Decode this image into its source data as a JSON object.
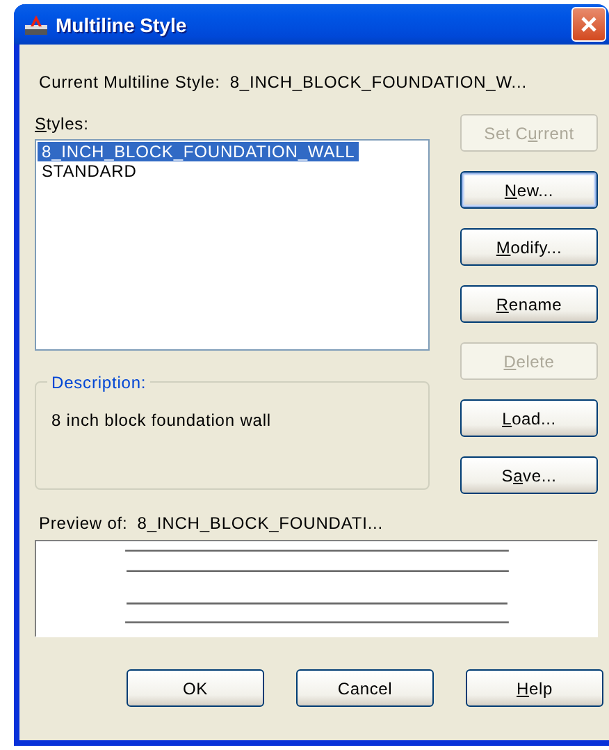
{
  "window": {
    "title": "Multiline Style"
  },
  "current_style": {
    "label": "Current Multiline Style:",
    "value": "8_INCH_BLOCK_FOUNDATION_W..."
  },
  "styles": {
    "label": {
      "key": "S",
      "after": "tyles:"
    },
    "items": [
      {
        "name": "8_INCH_BLOCK_FOUNDATION_WALL",
        "selected": true
      },
      {
        "name": "STANDARD",
        "selected": false
      }
    ]
  },
  "side_buttons": [
    {
      "label": {
        "before": "Set C",
        "key": "u",
        "after": "rrent"
      },
      "disabled": true,
      "default": false
    },
    {
      "label": {
        "key": "N",
        "after": "ew..."
      },
      "disabled": false,
      "default": true
    },
    {
      "label": {
        "key": "M",
        "after": "odify..."
      },
      "disabled": false,
      "default": false
    },
    {
      "label": {
        "key": "R",
        "after": "ename"
      },
      "disabled": false,
      "default": false
    },
    {
      "label": {
        "key": "D",
        "after": "elete"
      },
      "disabled": true,
      "default": false
    },
    {
      "label": {
        "key": "L",
        "after": "oad..."
      },
      "disabled": false,
      "default": false
    },
    {
      "label": {
        "before": "S",
        "key": "a",
        "after": "ve..."
      },
      "disabled": false,
      "default": false
    }
  ],
  "description": {
    "label": "Description:",
    "text": "8 inch block foundation wall"
  },
  "preview": {
    "label": "Preview of:",
    "value": "8_INCH_BLOCK_FOUNDATI..."
  },
  "bottom_buttons": [
    {
      "label": {
        "after": "OK"
      },
      "disabled": false,
      "default": false
    },
    {
      "label": {
        "after": "Cancel"
      },
      "disabled": false,
      "default": false
    },
    {
      "label": {
        "key": "H",
        "after": "elp"
      },
      "disabled": false,
      "default": false
    }
  ]
}
